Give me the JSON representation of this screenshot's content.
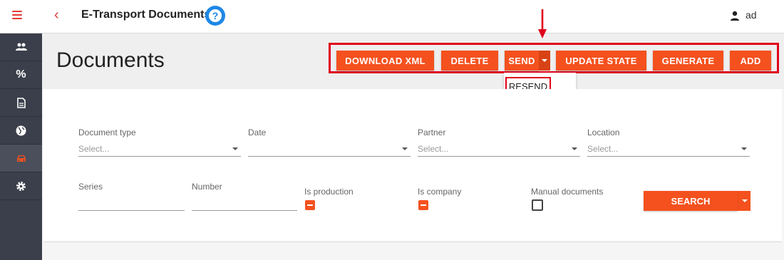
{
  "app": {
    "title": "E-Transport Documents",
    "help_icon": "question-circle-icon",
    "user_name": "ad"
  },
  "sidebar": {
    "items": [
      {
        "icon": "people-icon",
        "label": ""
      },
      {
        "icon": "percent-icon",
        "label": "%"
      },
      {
        "icon": "document-icon",
        "label": ""
      },
      {
        "icon": "globe-icon",
        "label": ""
      },
      {
        "icon": "car-icon",
        "label": "",
        "active": true
      },
      {
        "icon": "gear-icon",
        "label": ""
      }
    ]
  },
  "page": {
    "title": "Documents"
  },
  "actions": {
    "download_xml": "DOWNLOAD XML",
    "delete": "DELETE",
    "send": "SEND",
    "update_state": "UPDATE STATE",
    "generate": "GENERATE",
    "add": "ADD"
  },
  "send_menu": {
    "resend": "RESEND"
  },
  "filters": {
    "document_type": {
      "label": "Document type",
      "placeholder": "Select..."
    },
    "date": {
      "label": "Date",
      "value": ""
    },
    "partner": {
      "label": "Partner",
      "placeholder": "Select..."
    },
    "location": {
      "label": "Location",
      "placeholder": "Select..."
    },
    "series": {
      "label": "Series",
      "value": ""
    },
    "number": {
      "label": "Number",
      "value": ""
    },
    "is_production": {
      "label": "Is production",
      "checked": true
    },
    "is_company": {
      "label": "Is company",
      "checked": true
    },
    "manual_documents": {
      "label": "Manual documents",
      "checked": false
    },
    "search": "SEARCH"
  },
  "colors": {
    "accent": "#f4511e",
    "highlight": "#e0001b",
    "sidebar": "#3a3f4b",
    "help": "#1e88e5"
  }
}
